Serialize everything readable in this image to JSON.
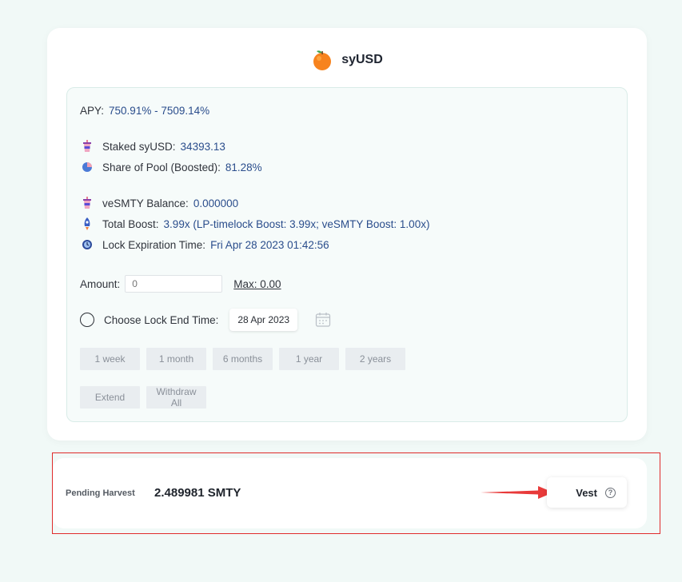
{
  "header": {
    "token_name": "syUSD",
    "token_icon": "orange-icon"
  },
  "stats": {
    "apy_label": "APY:",
    "apy_value": "750.91% - 7509.14%",
    "staked_label": "Staked syUSD:",
    "staked_value": "34393.13",
    "share_label": "Share of Pool (Boosted):",
    "share_value": "81.28%",
    "vesmty_label": "veSMTY Balance:",
    "vesmty_value": "0.000000",
    "boost_label": "Total Boost:",
    "boost_value": "3.99x (LP-timelock Boost: 3.99x; veSMTY Boost: 1.00x)",
    "lock_label": "Lock Expiration Time:",
    "lock_value": "Fri Apr 28 2023 01:42:56"
  },
  "amount": {
    "label": "Amount:",
    "placeholder": "0",
    "max_label": "Max: 0.00"
  },
  "lock_end": {
    "label": "Choose Lock End Time:",
    "date": "28 Apr 2023"
  },
  "durations": [
    "1 week",
    "1 month",
    "6 months",
    "1 year",
    "2 years"
  ],
  "actions": {
    "extend": "Extend",
    "withdraw_all": "Withdraw All"
  },
  "harvest": {
    "label": "Pending Harvest",
    "value": "2.489981 SMTY",
    "vest_label": "Vest",
    "help": "?"
  },
  "colors": {
    "accent_value": "#2a4d8c",
    "background": "#f1f9f7",
    "highlight_frame": "#e02b2b",
    "arrow": "#e83a3a"
  }
}
